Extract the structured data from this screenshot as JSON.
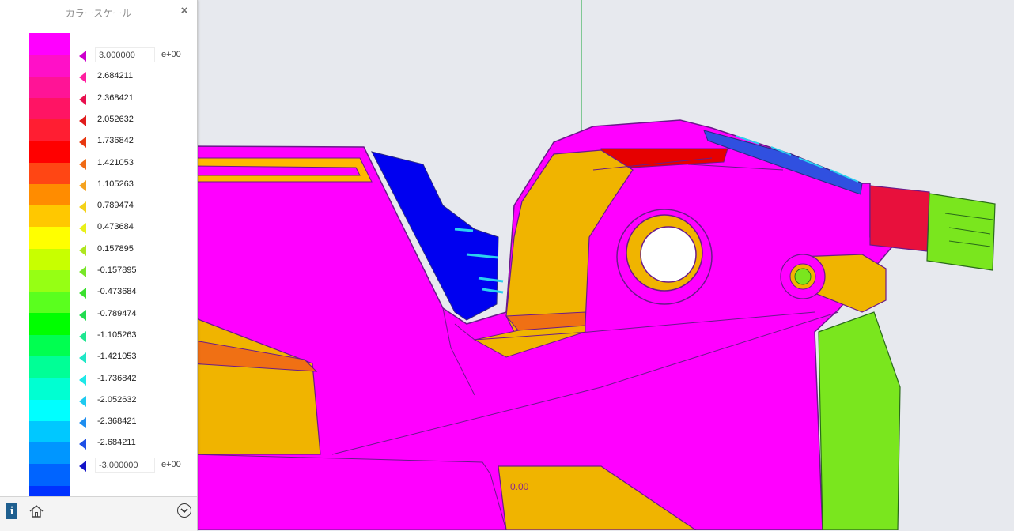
{
  "panel": {
    "title": "カラースケール",
    "close_glyph": "×",
    "footer": {
      "info_glyph": "i",
      "home_icon": "home-icon",
      "expand_icon": "chevron-down-circle-icon"
    }
  },
  "color_scale": {
    "max_value": "3.000000",
    "min_value": "-3.000000",
    "max_exponent": "e+00",
    "min_exponent": "e+00",
    "labels": [
      {
        "text": "3.000000",
        "color": "#cc00cc",
        "editable": true
      },
      {
        "text": "2.684211",
        "color": "#ff1fa0"
      },
      {
        "text": "2.368421",
        "color": "#e8104e"
      },
      {
        "text": "2.052632",
        "color": "#e01c1c"
      },
      {
        "text": "1.736842",
        "color": "#e83810"
      },
      {
        "text": "1.421053",
        "color": "#f06a14"
      },
      {
        "text": "1.105263",
        "color": "#f5a21e"
      },
      {
        "text": "0.789474",
        "color": "#f4d21a"
      },
      {
        "text": "0.473684",
        "color": "#e8f019"
      },
      {
        "text": "0.157895",
        "color": "#aee61e"
      },
      {
        "text": "-0.157895",
        "color": "#78e628"
      },
      {
        "text": "-0.473684",
        "color": "#3ae02e"
      },
      {
        "text": "-0.789474",
        "color": "#22dc50"
      },
      {
        "text": "-1.105263",
        "color": "#1ee690"
      },
      {
        "text": "-1.421053",
        "color": "#1ee6c6"
      },
      {
        "text": "-1.736842",
        "color": "#1ee8e8"
      },
      {
        "text": "-2.052632",
        "color": "#1ecaf0"
      },
      {
        "text": "-2.368421",
        "color": "#1e8ef0"
      },
      {
        "text": "-2.684211",
        "color": "#1e50e6"
      },
      {
        "text": "-3.000000",
        "color": "#1414c8",
        "editable": true
      }
    ],
    "bands": [
      "#ff00ff",
      "#ff10c8",
      "#ff1496",
      "#ff1464",
      "#ff1e32",
      "#ff0000",
      "#ff4614",
      "#ff8c00",
      "#ffc800",
      "#ffff00",
      "#c8ff00",
      "#96ff14",
      "#5aff1e",
      "#00ff00",
      "#00ff50",
      "#00ff96",
      "#00ffd2",
      "#00ffff",
      "#00c8ff",
      "#0096ff",
      "#0064ff",
      "#0032ff",
      "#0000ff"
    ]
  },
  "viewport": {
    "watermark_text": "0.00"
  }
}
